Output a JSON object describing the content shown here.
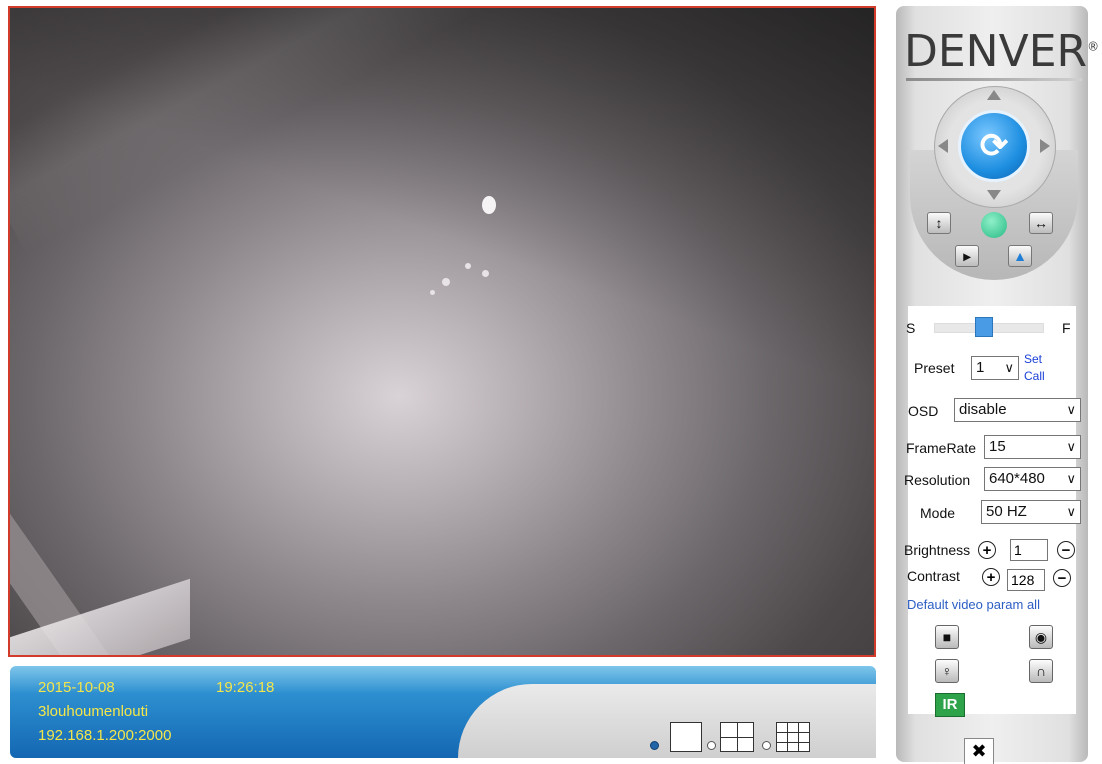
{
  "video": {
    "info": {
      "date": "2015-10-08",
      "time": "19:26:18",
      "device_name": "3louhoumenlouti",
      "address": "192.168.1.200:2000"
    }
  },
  "layout_options": [
    {
      "icon": "single-view-icon",
      "selected": true
    },
    {
      "icon": "quad-view-icon",
      "selected": false
    },
    {
      "icon": "nine-view-icon",
      "selected": false
    }
  ],
  "brand": {
    "logo_text": "DENVER",
    "registered_mark": "®"
  },
  "ptz": {
    "center_icon": "refresh-icon",
    "buttons": [
      "vertical-flip-icon",
      "status-dot",
      "horizontal-flip-icon",
      "play-right-icon",
      "mirror-icon"
    ]
  },
  "speed": {
    "slow_label": "S",
    "fast_label": "F",
    "level": 0.45
  },
  "preset": {
    "label": "Preset",
    "value": "1",
    "set_label": "Set",
    "call_label": "Call"
  },
  "osd": {
    "label": "OSD",
    "value": "disable"
  },
  "framerate": {
    "label": "FrameRate",
    "value": "15"
  },
  "resolution": {
    "label": "Resolution",
    "value": "640*480"
  },
  "mode": {
    "label": "Mode",
    "value": "50 HZ"
  },
  "brightness": {
    "label": "Brightness",
    "value": "1",
    "plus": "+",
    "minus": "−"
  },
  "contrast": {
    "label": "Contrast",
    "value": "128",
    "plus": "+",
    "minus": "−"
  },
  "default_link": "Default video param all",
  "action_icons": [
    "record-icon",
    "snapshot-icon",
    "talk-icon",
    "listen-icon"
  ],
  "ir_label": "IR",
  "settings_icon": "tools-icon"
}
